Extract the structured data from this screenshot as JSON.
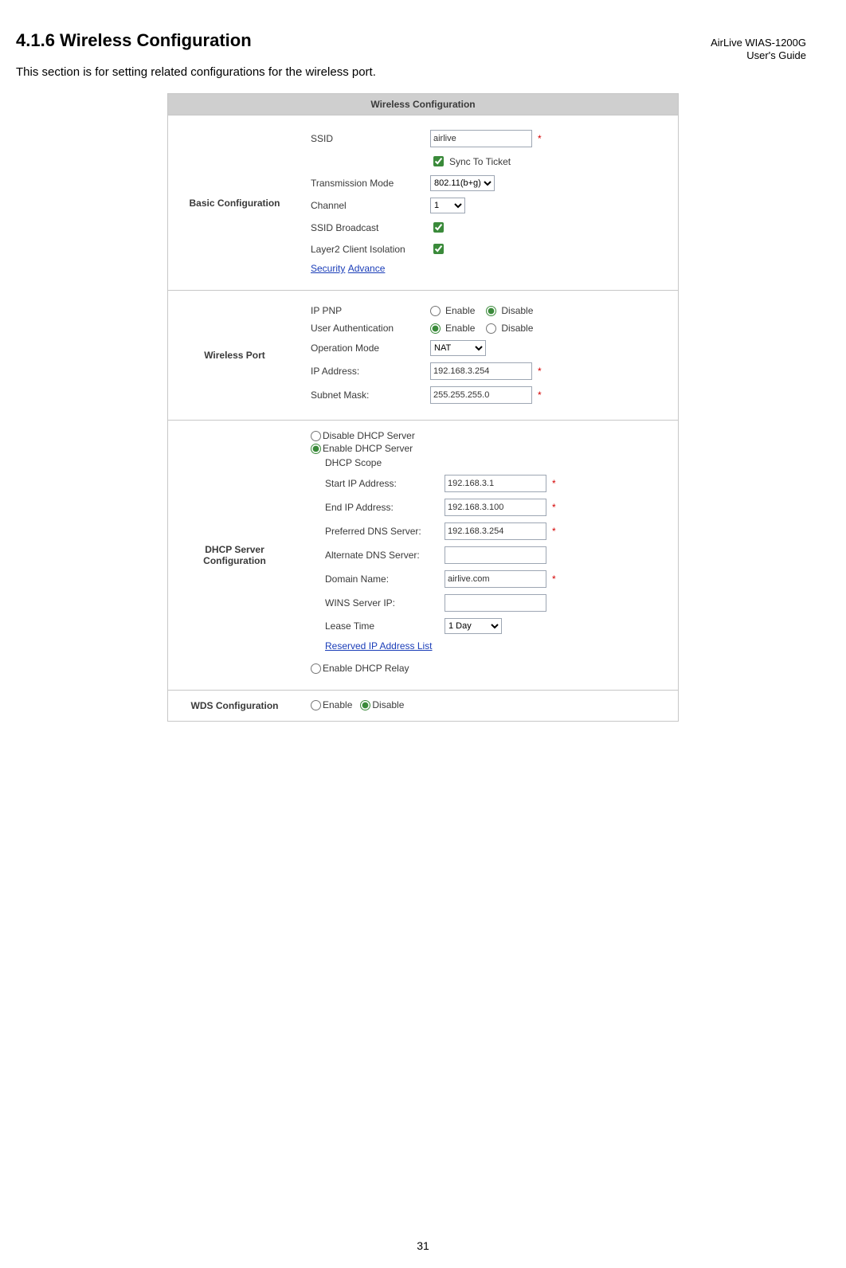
{
  "header": {
    "line1": "AirLive WIAS-1200G",
    "line2": "User's Guide"
  },
  "title": "4.1.6 Wireless Configuration",
  "intro": "This section is for setting related configurations for the wireless port.",
  "panel": {
    "title": "Wireless Configuration",
    "basic": {
      "section_label": "Basic Configuration",
      "ssid_label": "SSID",
      "ssid_value": "airlive",
      "sync_label": "Sync To Ticket",
      "trans_label": "Transmission Mode",
      "trans_value": "802.11(b+g)",
      "channel_label": "Channel",
      "channel_value": "1",
      "broadcast_label": "SSID Broadcast",
      "l2iso_label": "Layer2 Client Isolation",
      "security_link": "Security",
      "advance_link": "Advance"
    },
    "wport": {
      "section_label": "Wireless Port",
      "ippnp_label": "IP PNP",
      "userauth_label": "User Authentication",
      "enable": "Enable",
      "disable": "Disable",
      "opmode_label": "Operation Mode",
      "opmode_value": "NAT",
      "ipaddr_label": "IP Address:",
      "ipaddr_value": "192.168.3.254",
      "subnet_label": "Subnet Mask:",
      "subnet_value": "255.255.255.0"
    },
    "dhcp": {
      "section_label": "DHCP Server Configuration",
      "opt_disable": "Disable DHCP Server",
      "opt_enable": "Enable DHCP Server",
      "scope_label": "DHCP Scope",
      "start_label": "Start IP Address:",
      "start_value": "192.168.3.1",
      "end_label": "End IP Address:",
      "end_value": "192.168.3.100",
      "pdns_label": "Preferred DNS Server:",
      "pdns_value": "192.168.3.254",
      "adns_label": "Alternate DNS Server:",
      "adns_value": "",
      "domain_label": "Domain Name:",
      "domain_value": "airlive.com",
      "wins_label": "WINS Server IP:",
      "wins_value": "",
      "lease_label": "Lease Time",
      "lease_value": "1 Day",
      "reserved_link": "Reserved IP Address List",
      "opt_relay": "Enable DHCP Relay"
    },
    "wds": {
      "section_label": "WDS Configuration",
      "enable": "Enable",
      "disable": "Disable"
    }
  },
  "page_number": "31"
}
